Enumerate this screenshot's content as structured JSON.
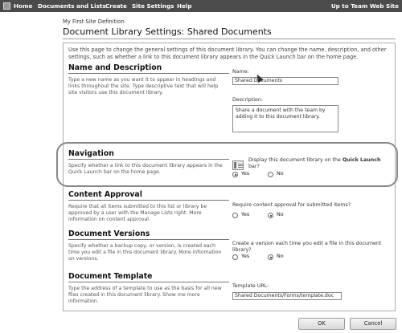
{
  "top_nav": {
    "items": [
      "Home",
      "Documents and Lists",
      "Create",
      "Site Settings",
      "Help"
    ],
    "right_link": "Up to Team Web Site"
  },
  "header": {
    "site_name": "My First Site Definition",
    "page_title": "Document Library Settings: Shared Documents"
  },
  "intro": "Use this page to change the general settings of this document library. You can change the name, description, and other settings, such as whether a link to this document library appears in the Quick Launch bar on the home page.",
  "sections": {
    "name_description": {
      "title": "Name and Description",
      "description": "Type a new name as you want it to appear in headings and links throughout the site. Type descriptive text that will help site visitors use this document library.",
      "name_label": "Name:",
      "name_value": "Shared Documents",
      "description_label": "Description:",
      "description_value": "Share a document with the team by adding it to this document library."
    },
    "navigation": {
      "title": "Navigation",
      "description": "Specify whether a link to this document library appears in the Quick Launch bar on the home page.",
      "question_prefix": "Display this document library on the",
      "question_bold": "Quick Launch",
      "question_suffix": "bar?",
      "yes": "Yes",
      "no": "No",
      "selected": "Yes"
    },
    "content_approval": {
      "title": "Content Approval",
      "description": "Require that all items submitted to this list or library be approved by a user with the Manage Lists right. More information on content approval.",
      "question": "Require content approval for submitted items?",
      "yes": "Yes",
      "no": "No",
      "selected": "No"
    },
    "document_versions": {
      "title": "Document Versions",
      "description": "Specify whether a backup copy, or version, is created each time you edit a file in this document library. More information on versions.",
      "question": "Create a version each time you edit a file in this document library?",
      "yes": "Yes",
      "no": "No",
      "selected": "No"
    },
    "document_template": {
      "title": "Document Template",
      "description": "Type the address of a template to use as the basis for all new files created in this document library. Show me more information.",
      "url_label": "Template URL:",
      "url_value": "Shared Documents/Forms/template.doc"
    }
  },
  "buttons": {
    "ok": "OK",
    "cancel": "Cancel"
  }
}
